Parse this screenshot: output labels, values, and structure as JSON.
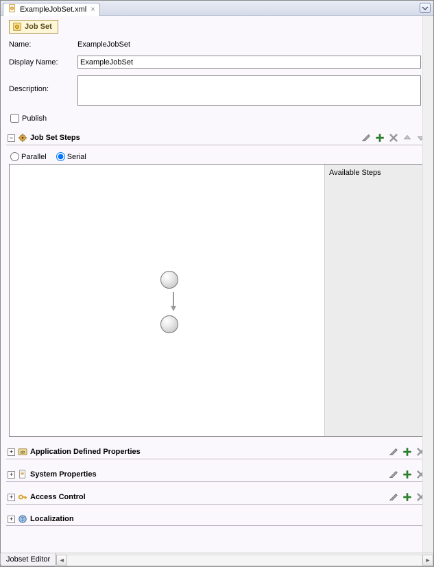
{
  "tab": {
    "filename": "ExampleJobSet.xml"
  },
  "header": {
    "title": "Job Set"
  },
  "form": {
    "name_label": "Name:",
    "name_value": "ExampleJobSet",
    "displayname_label": "Display Name:",
    "displayname_value": "ExampleJobSet",
    "description_label": "Description:",
    "description_value": "",
    "publish_label": "Publish"
  },
  "sections": {
    "steps": {
      "label": "Job Set Steps"
    },
    "appprops": {
      "label": "Application Defined Properties"
    },
    "sysprops": {
      "label": "System Properties"
    },
    "access": {
      "label": "Access Control"
    },
    "localization": {
      "label": "Localization"
    }
  },
  "steps": {
    "parallel_label": "Parallel",
    "serial_label": "Serial",
    "available_label": "Available Steps"
  },
  "footer": {
    "tab_label": "Jobset Editor"
  }
}
